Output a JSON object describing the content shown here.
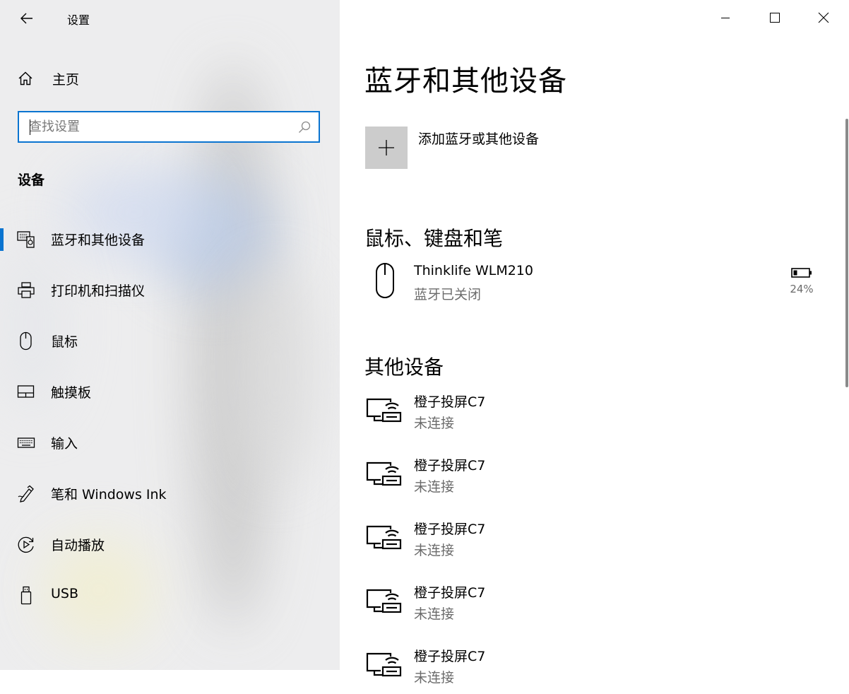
{
  "app": {
    "title": "设置"
  },
  "sidebar": {
    "home_label": "主页",
    "search_placeholder": "查找设置",
    "search_value": "",
    "section_heading": "设备",
    "items": [
      {
        "label": "蓝牙和其他设备",
        "icon": "bluetooth-devices-icon",
        "selected": true
      },
      {
        "label": "打印机和扫描仪",
        "icon": "printer-icon",
        "selected": false
      },
      {
        "label": "鼠标",
        "icon": "mouse-icon",
        "selected": false
      },
      {
        "label": "触摸板",
        "icon": "touchpad-icon",
        "selected": false
      },
      {
        "label": "输入",
        "icon": "keyboard-icon",
        "selected": false
      },
      {
        "label": "笔和 Windows Ink",
        "icon": "pen-icon",
        "selected": false
      },
      {
        "label": "自动播放",
        "icon": "autoplay-icon",
        "selected": false
      },
      {
        "label": "USB",
        "icon": "usb-icon",
        "selected": false
      }
    ]
  },
  "main": {
    "title": "蓝牙和其他设备",
    "add_device_label": "添加蓝牙或其他设备",
    "groups": [
      {
        "heading": "鼠标、键盘和笔",
        "devices": [
          {
            "name": "Thinklife WLM210",
            "status": "蓝牙已关闭",
            "icon": "mouse-icon",
            "battery": "24%"
          }
        ]
      },
      {
        "heading": "其他设备",
        "devices": [
          {
            "name": "橙子投屏C7",
            "status": "未连接",
            "icon": "wireless-display-icon"
          },
          {
            "name": "橙子投屏C7",
            "status": "未连接",
            "icon": "wireless-display-icon"
          },
          {
            "name": "橙子投屏C7",
            "status": "未连接",
            "icon": "wireless-display-icon"
          },
          {
            "name": "橙子投屏C7",
            "status": "未连接",
            "icon": "wireless-display-icon"
          },
          {
            "name": "橙子投屏C7",
            "status": "未连接",
            "icon": "wireless-display-icon"
          }
        ]
      }
    ]
  },
  "colors": {
    "accent": "#0a74d0",
    "secondary_text": "#6b6b6b",
    "tile": "#cccccc"
  }
}
